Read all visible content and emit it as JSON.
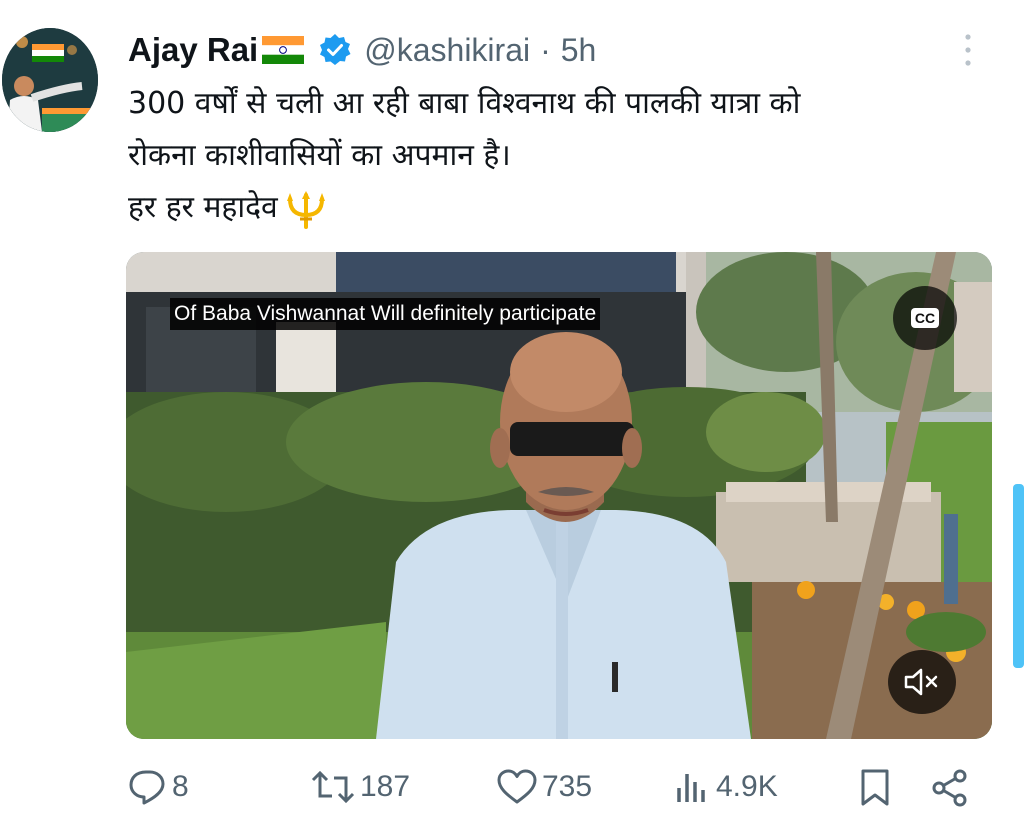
{
  "tweet": {
    "author_name": "Ajay Rai",
    "handle": "@kashikirai",
    "separator": "·",
    "time": "5h",
    "text_lines": [
      "300 वर्षों से चली आ रही बाबा विश्वनाथ की पालकी यात्रा को",
      "रोकना काशीवासियों का अपमान है।",
      "हर हर महादेव"
    ]
  },
  "media": {
    "caption": "Of Baba Vishwannat Will definitely participate",
    "cc_label": "CC"
  },
  "actions": {
    "replies": "8",
    "reposts": "187",
    "likes": "735",
    "views": "4.9K"
  },
  "icons": {
    "verified": "verified-badge-icon",
    "flag": "india-flag-icon",
    "trident": "trident-icon",
    "reply": "reply-icon",
    "repost": "repost-icon",
    "like": "heart-icon",
    "views": "views-icon",
    "bookmark": "bookmark-icon",
    "share": "share-icon"
  },
  "colors": {
    "accent": "#1d9bf0",
    "secondary_text": "#536471",
    "primary_text": "#0f1419"
  }
}
